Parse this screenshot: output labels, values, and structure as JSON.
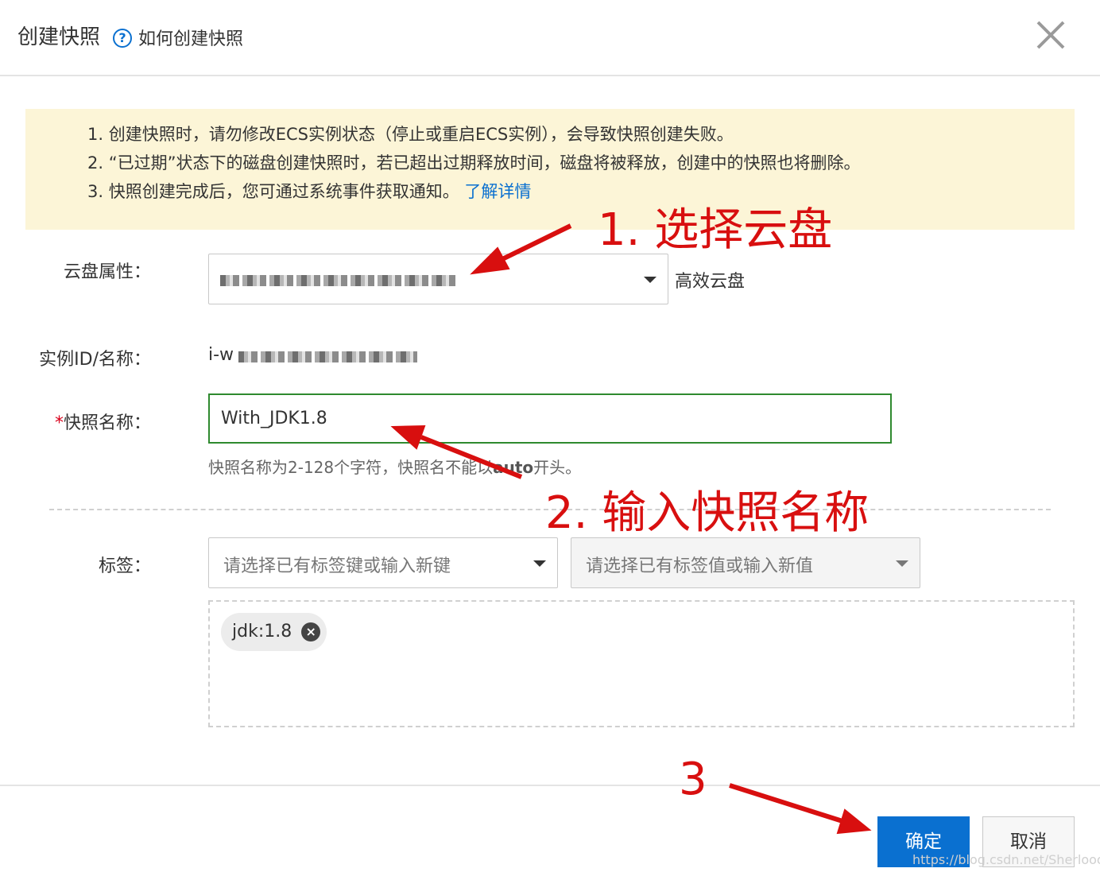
{
  "dialog": {
    "title": "创建快照",
    "help_link": "如何创建快照"
  },
  "notice": {
    "line1": "1. 创建快照时，请勿修改ECS实例状态（停止或重启ECS实例），会导致快照创建失败。",
    "line2": "2. “已过期”状态下的磁盘创建快照时，若已超出过期释放时间，磁盘将被释放，创建中的快照也将删除。",
    "line3_text": "3. 快照创建完成后，您可通过系统事件获取通知。",
    "line3_link": "了解详情"
  },
  "form": {
    "disk_label": "云盘属性：",
    "disk_type": "高效云盘",
    "instance_label": "实例ID/名称：",
    "instance_prefix": "i-w",
    "name_label": "快照名称：",
    "name_required_mark": "*",
    "name_value": "With_JDK1.8",
    "name_hint_prefix": "快照名称为2-128个字符，快照名不能以",
    "name_hint_bold": "auto",
    "name_hint_suffix": "开头。",
    "tags_label": "标签：",
    "tag_key_placeholder": "请选择已有标签键或输入新键",
    "tag_value_placeholder": "请选择已有标签值或输入新值",
    "tags": [
      {
        "label": "jdk:1.8"
      }
    ]
  },
  "buttons": {
    "confirm": "确定",
    "cancel": "取消"
  },
  "annotations": {
    "step1": "1. 选择云盘",
    "step2": "2. 输入快照名称",
    "step3": "3"
  },
  "watermark": "https://blog.csdn.net/Sherlooock",
  "colors": {
    "primary": "#0a70d0",
    "annotation": "#d80f0f",
    "notice_bg": "#fcf5d7",
    "input_focus_border": "#2f8a2f",
    "required": "#d9001b"
  },
  "icons": {
    "help": "question-circle-icon",
    "close": "close-icon",
    "caret": "caret-down-icon",
    "tag_remove": "close-circle-icon"
  }
}
